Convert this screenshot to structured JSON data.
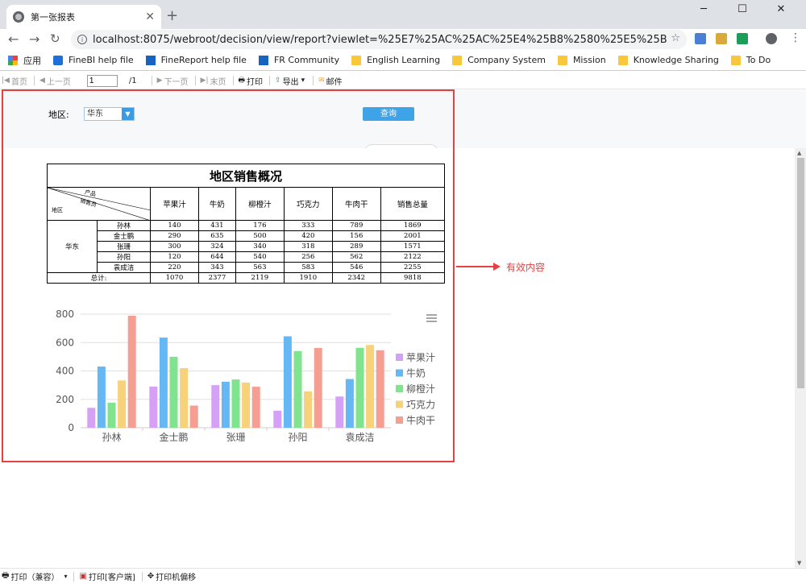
{
  "browser": {
    "tab_title": "第一张报表",
    "url": "localhost:8075/webroot/decision/view/report?viewlet=%25E7%25AC%25AC%25E4%25B8%2580%25E5%25BC%25A0%25E6%258..."
  },
  "bookmarks": [
    {
      "label": "应用",
      "icon": "apps-grid-icon"
    },
    {
      "label": "FineBI help file",
      "icon": "finebi-icon"
    },
    {
      "label": "FineReport help file",
      "icon": "finereport-icon"
    },
    {
      "label": "FR Community",
      "icon": "finereport-icon"
    },
    {
      "label": "English Learning",
      "icon": "folder-icon"
    },
    {
      "label": "Company System",
      "icon": "folder-icon"
    },
    {
      "label": "Mission",
      "icon": "folder-icon"
    },
    {
      "label": "Knowledge Sharing",
      "icon": "folder-icon"
    },
    {
      "label": "To Do",
      "icon": "folder-icon"
    }
  ],
  "report_toolbar": {
    "first": "首页",
    "prev": "上一页",
    "page_value": "1",
    "page_total": "/1",
    "next": "下一页",
    "last": "末页",
    "print": "打印",
    "export": "导出",
    "email": "邮件"
  },
  "params": {
    "region_label": "地区:",
    "region_value": "华东",
    "query_button": "查询"
  },
  "report": {
    "title": "地区销售概况",
    "corner": {
      "product": "产品",
      "salesperson": "销售员",
      "region": "地区"
    },
    "columns": [
      "苹果汁",
      "牛奶",
      "柳橙汁",
      "巧克力",
      "牛肉干",
      "销售总量"
    ],
    "region": "华东",
    "rows": [
      {
        "name": "孙林",
        "values": [
          "140",
          "431",
          "176",
          "333",
          "789",
          "1869"
        ]
      },
      {
        "name": "金士鹏",
        "values": [
          "290",
          "635",
          "500",
          "420",
          "156",
          "2001"
        ]
      },
      {
        "name": "张珊",
        "values": [
          "300",
          "324",
          "340",
          "318",
          "289",
          "1571"
        ]
      },
      {
        "name": "孙阳",
        "values": [
          "120",
          "644",
          "540",
          "256",
          "562",
          "2122"
        ]
      },
      {
        "name": "袁成洁",
        "values": [
          "220",
          "343",
          "563",
          "583",
          "546",
          "2255"
        ]
      }
    ],
    "total_label": "总计:",
    "totals": [
      "1070",
      "2377",
      "2119",
      "1910",
      "2342",
      "9818"
    ]
  },
  "chart_data": {
    "type": "bar",
    "categories": [
      "孙林",
      "金士鹏",
      "张珊",
      "孙阳",
      "袁成洁"
    ],
    "series": [
      {
        "name": "苹果汁",
        "color": "#d5a0f5",
        "values": [
          140,
          290,
          300,
          120,
          220
        ]
      },
      {
        "name": "牛奶",
        "color": "#66b8f5",
        "values": [
          431,
          635,
          324,
          644,
          343
        ]
      },
      {
        "name": "柳橙汁",
        "color": "#80e38e",
        "values": [
          176,
          500,
          340,
          540,
          563
        ]
      },
      {
        "name": "巧克力",
        "color": "#f8d27a",
        "values": [
          333,
          420,
          318,
          256,
          583
        ]
      },
      {
        "name": "牛肉干",
        "color": "#f79e92",
        "values": [
          789,
          156,
          289,
          562,
          546
        ]
      }
    ],
    "yticks": [
      "0",
      "200",
      "400",
      "600",
      "800"
    ],
    "ylim": [
      0,
      800
    ],
    "legend": "right",
    "grid": true
  },
  "annotation": {
    "text": "有效内容",
    "color": "#e84040"
  },
  "bottom_bar": {
    "print_compat": "打印（兼容）",
    "print_client": "打印[客户端]",
    "printer_offset": "打印机偏移"
  }
}
